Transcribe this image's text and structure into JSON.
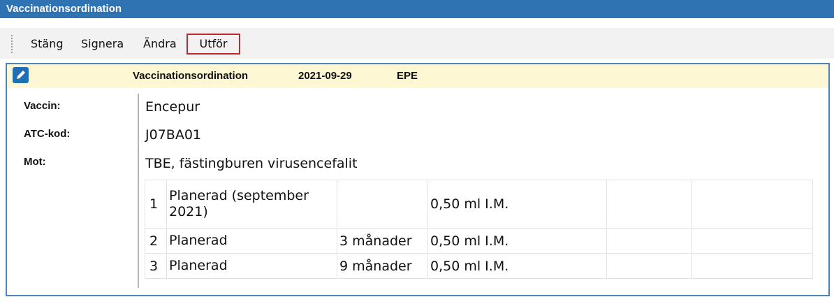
{
  "window": {
    "title": "Vaccinationsordination"
  },
  "toolbar": {
    "buttons": [
      "Stäng",
      "Signera",
      "Ändra",
      "Utför"
    ],
    "highlight_color": "#c0282d"
  },
  "header": {
    "icon": "edit-icon",
    "title": "Vaccinationsordination",
    "date": "2021-09-29",
    "user": "EPE",
    "background": "#fdf8d3"
  },
  "fields": [
    {
      "label": "Vaccin:",
      "value": "Encepur"
    },
    {
      "label": "ATC-kod:",
      "value": "J07BA01"
    },
    {
      "label": "Mot:",
      "value": "TBE, fästingburen virusencefalit"
    }
  ],
  "doses": [
    {
      "number": "1",
      "status": "Planerad (september 2021)",
      "interval": "",
      "dose": "0,50 ml I.M."
    },
    {
      "number": "2",
      "status": "Planerad",
      "interval": "3 månader",
      "dose": "0,50 ml I.M."
    },
    {
      "number": "3",
      "status": "Planerad",
      "interval": "9 månader",
      "dose": "0,50 ml I.M."
    }
  ],
  "colors": {
    "titlebar": "#2f73b2",
    "frame_border": "#4a84bf"
  }
}
